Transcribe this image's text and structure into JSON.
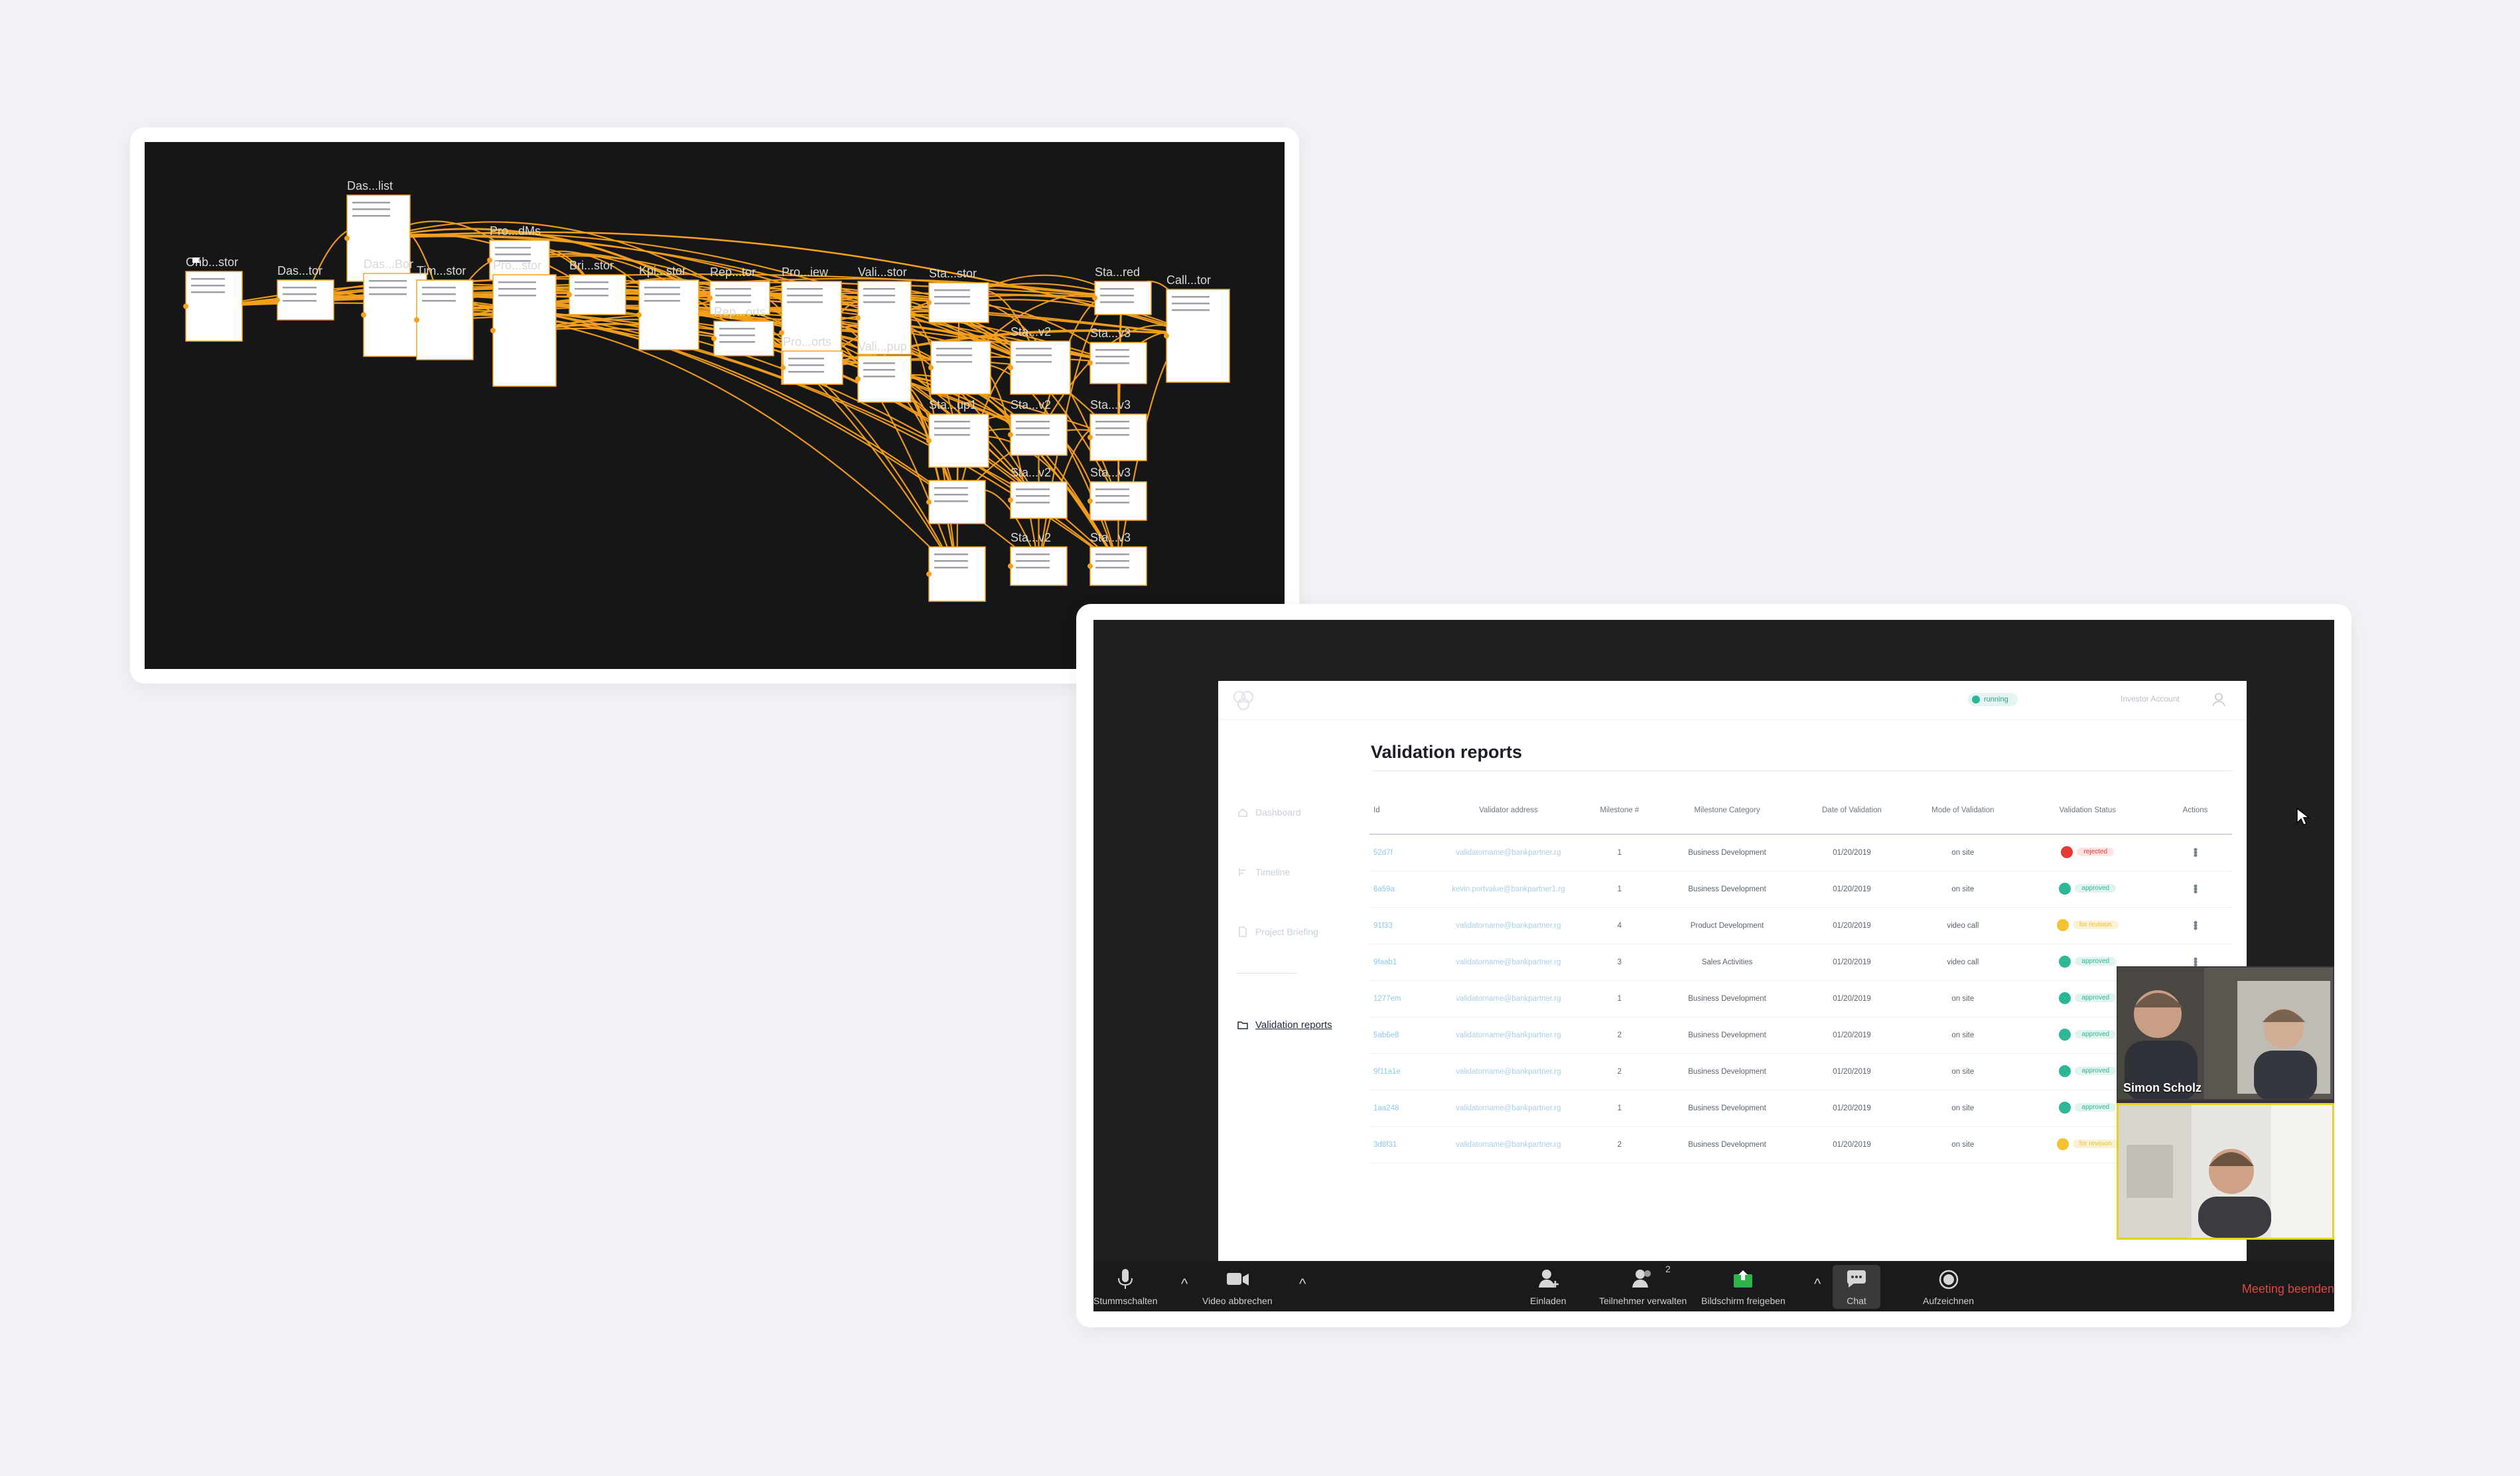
{
  "prototype": {
    "screens": [
      {
        "label": "Das...list"
      },
      {
        "label": "Pro...dMs"
      },
      {
        "label": "Das...Bor"
      },
      {
        "label": "Onb...stor"
      },
      {
        "label": "Das...tor"
      },
      {
        "label": "Tim...stor"
      },
      {
        "label": "Pro...stor"
      },
      {
        "label": "Bri...stor"
      },
      {
        "label": "Kpi...stor"
      },
      {
        "label": "Rep...tor"
      },
      {
        "label": "Pro...iew"
      },
      {
        "label": "Vali...stor"
      },
      {
        "label": "Sta...stor"
      },
      {
        "label": "Sta...red"
      },
      {
        "label": "Call...tor"
      },
      {
        "label": "Rep...orts"
      },
      {
        "label": "Pro...orts"
      },
      {
        "label": "Vali...pup"
      },
      {
        "label": "Sta...v2"
      },
      {
        "label": "Sta...v3"
      },
      {
        "label": "Sta...up1"
      },
      {
        "label": "Sta...v2"
      },
      {
        "label": "Sta...v3"
      },
      {
        "label": "Sta...v2"
      },
      {
        "label": "Sta...v3"
      },
      {
        "label": "Sta...v2"
      },
      {
        "label": "Sta...v3"
      }
    ],
    "colors": {
      "canvas": "#161616",
      "connector": "#f5a01e",
      "screen": "#ffffff"
    }
  },
  "app": {
    "status": "running",
    "account": "Investor Account",
    "sidebar": [
      {
        "label": "Dashboard",
        "icon": "home-icon"
      },
      {
        "label": "Timeline",
        "icon": "timeline-icon"
      },
      {
        "label": "Project Briefing",
        "icon": "document-icon"
      },
      {
        "label": "Validation reports",
        "icon": "folder-icon",
        "active": true
      }
    ],
    "page_title": "Validation reports",
    "table": {
      "headers": [
        "Id",
        "Validator address",
        "Milestone #",
        "Milestone Category",
        "Date of Validation",
        "Mode of Validation",
        "Validation Status",
        "Actions"
      ],
      "rows": [
        {
          "id": "52d7f",
          "address": "validatorname@bankpartner.rg",
          "milestone": "1",
          "category": "Business Development",
          "date": "01/20/2019",
          "mode": "on site",
          "status": "rejected",
          "status_color": "#e53935",
          "status_bg": "#fde3e2"
        },
        {
          "id": "6a59a",
          "address": "kevin.portvalue@bankpartner1.rg",
          "milestone": "1",
          "category": "Business Development",
          "date": "01/20/2019",
          "mode": "on site",
          "status": "approved",
          "status_color": "#2cb896",
          "status_bg": "#e1f3ee"
        },
        {
          "id": "91f33",
          "address": "validatorname@bankpartner.rg",
          "milestone": "4",
          "category": "Product Development",
          "date": "01/20/2019",
          "mode": "video call",
          "status": "for revision",
          "status_color": "#f2c233",
          "status_bg": "#fbf1d4"
        },
        {
          "id": "9faab1",
          "address": "validatorname@bankpartner.rg",
          "milestone": "3",
          "category": "Sales Activities",
          "date": "01/20/2019",
          "mode": "video call",
          "status": "approved",
          "status_color": "#2cb896",
          "status_bg": "#e1f3ee"
        },
        {
          "id": "1277em",
          "address": "validatorname@bankpartner.rg",
          "milestone": "1",
          "category": "Business Development",
          "date": "01/20/2019",
          "mode": "on site",
          "status": "approved",
          "status_color": "#2cb896",
          "status_bg": "#e1f3ee"
        },
        {
          "id": "5ab6e8",
          "address": "validatorname@bankpartner.rg",
          "milestone": "2",
          "category": "Business Development",
          "date": "01/20/2019",
          "mode": "on site",
          "status": "approved",
          "status_color": "#2cb896",
          "status_bg": "#e1f3ee"
        },
        {
          "id": "9f11a1e",
          "address": "validatorname@bankpartner.rg",
          "milestone": "2",
          "category": "Business Development",
          "date": "01/20/2019",
          "mode": "on site",
          "status": "approved",
          "status_color": "#2cb896",
          "status_bg": "#e1f3ee"
        },
        {
          "id": "1aa248",
          "address": "validatorname@bankpartner.rg",
          "milestone": "1",
          "category": "Business Development",
          "date": "01/20/2019",
          "mode": "on site",
          "status": "approved",
          "status_color": "#2cb896",
          "status_bg": "#e1f3ee"
        },
        {
          "id": "3d8f31",
          "address": "validatorname@bankpartner.rg",
          "milestone": "2",
          "category": "Business Development",
          "date": "01/20/2019",
          "mode": "on site",
          "status": "for revision",
          "status_color": "#f2c233",
          "status_bg": "#fbf1d4"
        }
      ]
    }
  },
  "zoom": {
    "speaker_name": "Simon Scholz",
    "toolbar": {
      "mute": "Stummschalten",
      "video": "Video abbrechen",
      "invite": "Einladen",
      "participants": "Teilnehmer verwalten",
      "participants_count": "2",
      "share": "Bildschirm freigeben",
      "chat": "Chat",
      "record": "Aufzeichnen",
      "end": "Meeting beenden"
    }
  }
}
